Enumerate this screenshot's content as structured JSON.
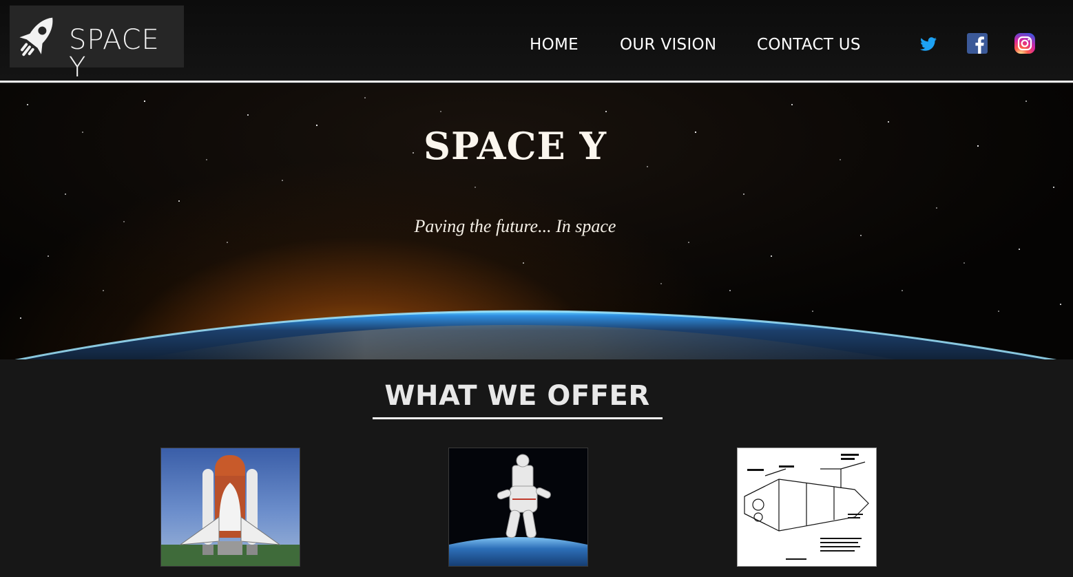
{
  "brand": {
    "logo_text": "SPACE Y",
    "logo_icon": "rocket-icon"
  },
  "nav": {
    "items": [
      {
        "label": "HOME"
      },
      {
        "label": "OUR VISION"
      },
      {
        "label": "CONTACT US"
      }
    ]
  },
  "social": [
    {
      "icon": "twitter-icon",
      "color": "#1da1f2"
    },
    {
      "icon": "facebook-icon",
      "color": "#3b5998"
    },
    {
      "icon": "instagram-icon",
      "color": "#d6249f"
    }
  ],
  "hero": {
    "title": "SPACE Y",
    "tagline": "Paving the future... In space"
  },
  "offer": {
    "heading": "WHAT WE OFFER",
    "cards": [
      {
        "image": "space-shuttle-launch-photo"
      },
      {
        "image": "astronaut-spacewalk-photo"
      },
      {
        "image": "shuttle-cutaway-diagram"
      }
    ]
  },
  "colors": {
    "header_bg": "#111111",
    "body_bg": "#171717",
    "text": "#ffffff"
  }
}
